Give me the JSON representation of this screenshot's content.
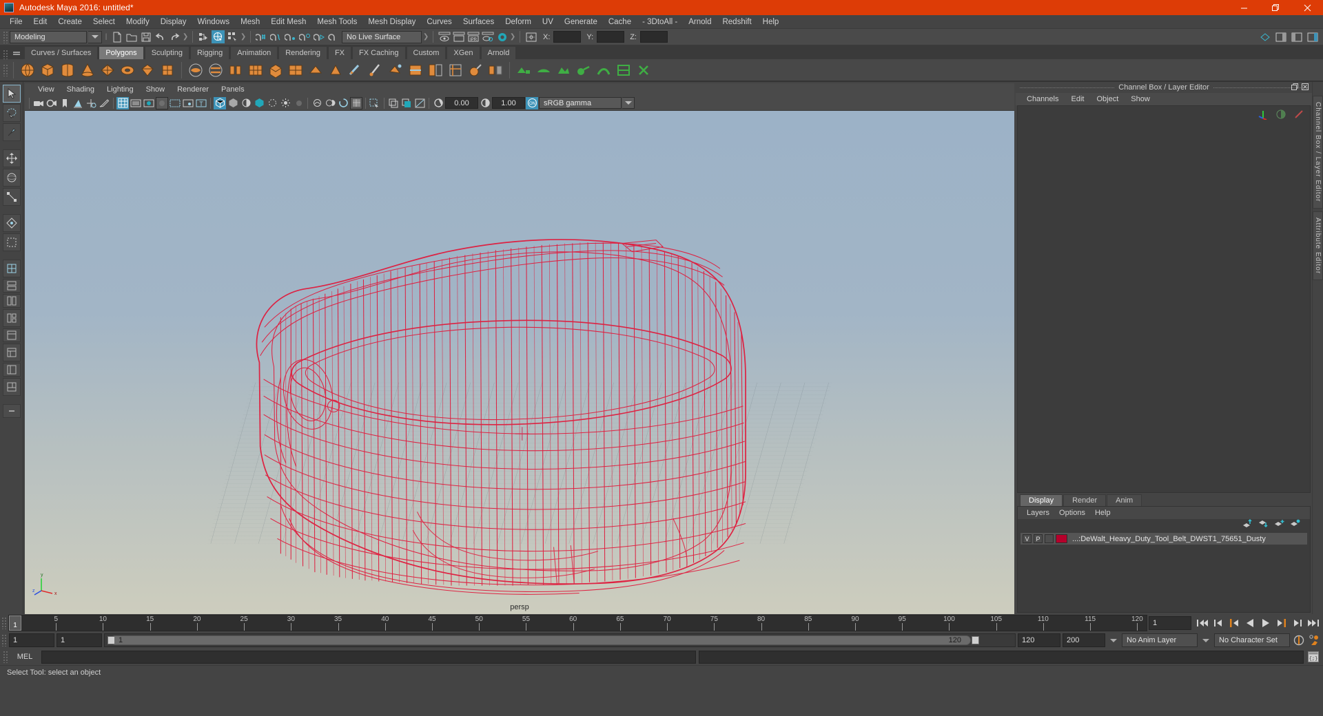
{
  "titlebar": {
    "title": "Autodesk Maya 2016: untitled*",
    "minimize": "—",
    "maximize": "❐",
    "close": "✕",
    "accent": "#dd3c06"
  },
  "menubar": {
    "items": [
      {
        "label": "File"
      },
      {
        "label": "Edit"
      },
      {
        "label": "Create"
      },
      {
        "label": "Select"
      },
      {
        "label": "Modify"
      },
      {
        "label": "Display"
      },
      {
        "label": "Windows"
      },
      {
        "label": "Mesh"
      },
      {
        "label": "Edit Mesh"
      },
      {
        "label": "Mesh Tools"
      },
      {
        "label": "Mesh Display"
      },
      {
        "label": "Curves"
      },
      {
        "label": "Surfaces"
      },
      {
        "label": "Deform"
      },
      {
        "label": "UV"
      },
      {
        "label": "Generate"
      },
      {
        "label": "Cache"
      },
      {
        "label": "- 3DtoAll -"
      },
      {
        "label": "Arnold"
      },
      {
        "label": "Redshift"
      },
      {
        "label": "Help"
      }
    ]
  },
  "statusline": {
    "menuset": "Modeling",
    "live_surface": "No Live Surface",
    "axis_x_label": "X:",
    "axis_y_label": "Y:",
    "axis_z_label": "Z:",
    "axis_x_value": "",
    "axis_y_value": "",
    "axis_z_value": "",
    "ipr_label": "IPR"
  },
  "shelf": {
    "tabs": [
      {
        "label": "Curves / Surfaces",
        "active": false
      },
      {
        "label": "Polygons",
        "active": true
      },
      {
        "label": "Sculpting",
        "active": false
      },
      {
        "label": "Rigging",
        "active": false
      },
      {
        "label": "Animation",
        "active": false
      },
      {
        "label": "Rendering",
        "active": false
      },
      {
        "label": "FX",
        "active": false
      },
      {
        "label": "FX Caching",
        "active": false
      },
      {
        "label": "Custom",
        "active": false
      },
      {
        "label": "XGen",
        "active": false
      },
      {
        "label": "Arnold",
        "active": false
      }
    ]
  },
  "viewport_panel": {
    "menu": [
      {
        "label": "View"
      },
      {
        "label": "Shading"
      },
      {
        "label": "Lighting"
      },
      {
        "label": "Show"
      },
      {
        "label": "Renderer"
      },
      {
        "label": "Panels"
      }
    ],
    "exposure_value": "0.00",
    "gamma_value": "1.00",
    "color_management": "sRGB gamma",
    "camera_label": "persp",
    "axis_labels": {
      "x": "x",
      "y": "y",
      "z": "z"
    }
  },
  "right_panel": {
    "title": "Channel Box / Layer Editor",
    "undock": "❐",
    "close": "✕",
    "channel_menu": [
      {
        "label": "Channels"
      },
      {
        "label": "Edit"
      },
      {
        "label": "Object"
      },
      {
        "label": "Show"
      }
    ],
    "layer_tabs": [
      {
        "label": "Display",
        "active": true
      },
      {
        "label": "Render",
        "active": false
      },
      {
        "label": "Anim",
        "active": false
      }
    ],
    "layer_menu": [
      {
        "label": "Layers"
      },
      {
        "label": "Options"
      },
      {
        "label": "Help"
      }
    ],
    "layers": [
      {
        "visibility": "V",
        "playback": "P",
        "shading": "",
        "color": "#b5002b",
        "name": "...:DeWalt_Heavy_Duty_Tool_Belt_DWST1_75651_Dusty"
      }
    ],
    "side_tabs": [
      "Channel Box / Layer Editor",
      "Attribute Editor"
    ]
  },
  "timeline": {
    "ticks": [
      5,
      10,
      15,
      20,
      25,
      30,
      35,
      40,
      45,
      50,
      55,
      60,
      65,
      70,
      75,
      80,
      85,
      90,
      95,
      100,
      105,
      110,
      115,
      120
    ],
    "current_frame_marker": "1",
    "current_frame_field": "1",
    "range_start": "1",
    "range_start2": "1",
    "range_bar_start_label": "1",
    "range_bar_end_label": "120",
    "range_end": "120",
    "playback_end": "200",
    "anim_layer": "No Anim Layer",
    "character_set": "No Character Set"
  },
  "command_line": {
    "label": "MEL",
    "input_value": "",
    "output_value": ""
  },
  "helpline": {
    "text": "Select Tool: select an object"
  },
  "colors": {
    "accent": "#dd3c06",
    "chrome": "#444444",
    "panel": "#3c3c3c",
    "active_blue": "#3d93b8",
    "wireframe_red": "#e01b3c",
    "shelf_orange": "#e08b3c"
  }
}
